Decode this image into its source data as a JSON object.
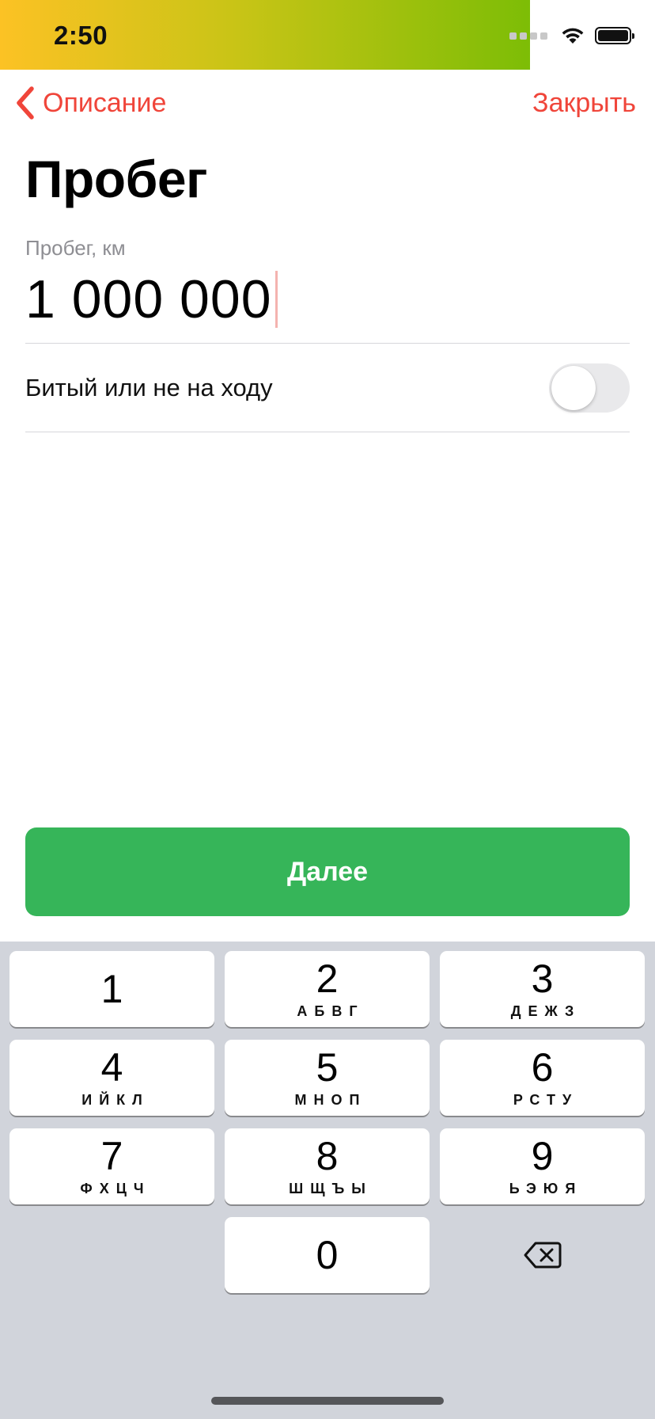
{
  "status_bar": {
    "time": "2:50",
    "icons": [
      "cellular-signal-icon",
      "wifi-icon",
      "battery-icon"
    ]
  },
  "nav": {
    "back_label": "Описание",
    "close_label": "Закрыть"
  },
  "page": {
    "title": "Пробег"
  },
  "mileage_field": {
    "label": "Пробег, км",
    "value": "1 000 000"
  },
  "damaged_toggle": {
    "label": "Битый или не на ходу",
    "on": false
  },
  "next_button": {
    "label": "Далее"
  },
  "keyboard": {
    "keys": [
      {
        "digit": "1",
        "letters": ""
      },
      {
        "digit": "2",
        "letters": "АБВГ"
      },
      {
        "digit": "3",
        "letters": "ДЕЖЗ"
      },
      {
        "digit": "4",
        "letters": "ИЙКЛ"
      },
      {
        "digit": "5",
        "letters": "МНОП"
      },
      {
        "digit": "6",
        "letters": "РСТУ"
      },
      {
        "digit": "7",
        "letters": "ФХЦЧ"
      },
      {
        "digit": "8",
        "letters": "ШЩЪЫ"
      },
      {
        "digit": "9",
        "letters": "ЬЭЮЯ"
      },
      {
        "digit": "0",
        "letters": ""
      }
    ],
    "backspace_icon": "backspace-icon"
  },
  "colors": {
    "accent_red": "#f0453a",
    "primary_green": "#36b559",
    "keyboard_bg": "#d1d4db"
  }
}
